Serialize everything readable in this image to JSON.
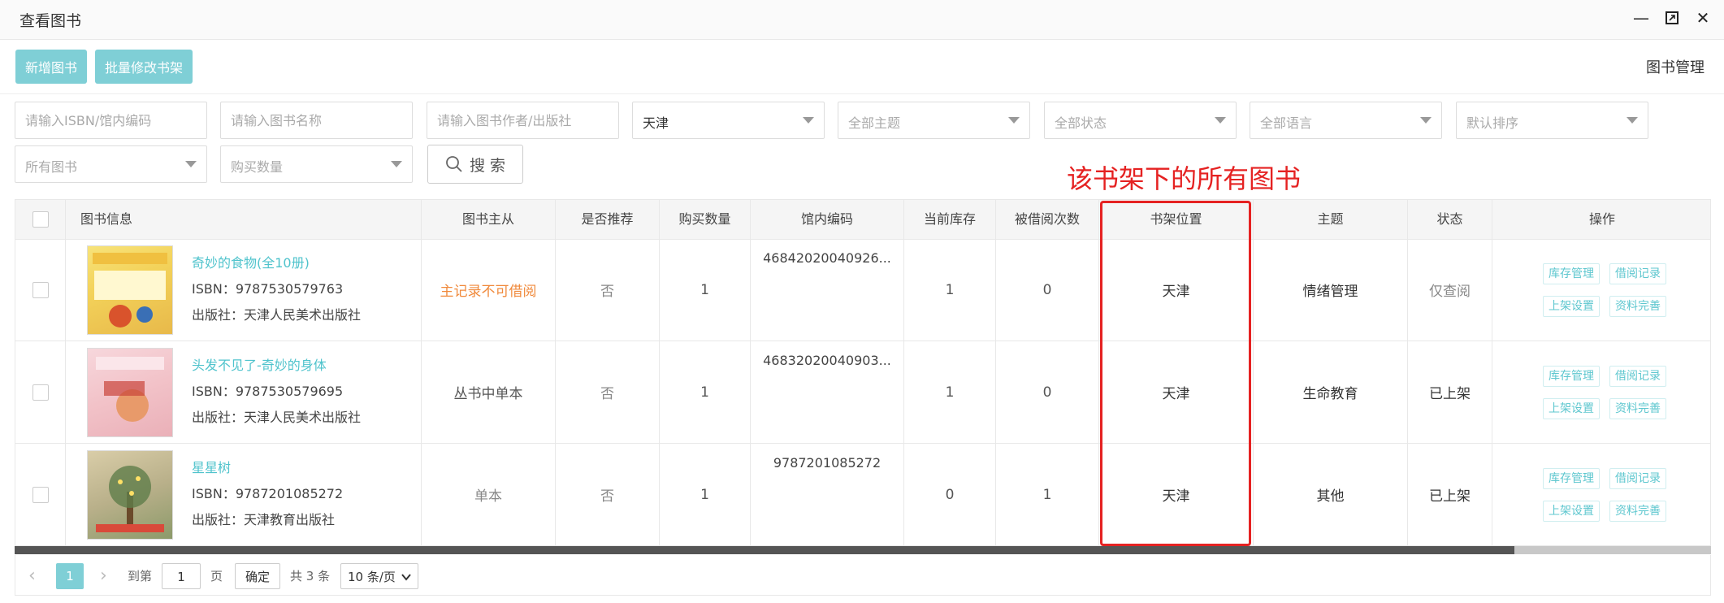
{
  "window": {
    "title": "查看图书",
    "controls": [
      "minimize",
      "maximize",
      "close"
    ]
  },
  "toolbar": {
    "add_book": "新增图书",
    "batch_shelf": "批量修改书架",
    "page_title": "图书管理"
  },
  "filters": {
    "isbn_placeholder": "请输入ISBN/馆内编码",
    "name_placeholder": "请输入图书名称",
    "author_placeholder": "请输入图书作者/出版社",
    "location_value": "天津",
    "theme": "全部主题",
    "status": "全部状态",
    "language": "全部语言",
    "sort": "默认排序",
    "scope": "所有图书",
    "purchase_count": "购买数量",
    "search_label": "搜 索"
  },
  "annotation": "该书架下的所有图书",
  "table": {
    "headers": {
      "book_info": "图书信息",
      "main_sub": "图书主从",
      "recommended": "是否推荐",
      "purchase": "购买数量",
      "code": "馆内编码",
      "stock": "当前库存",
      "borrows": "被借阅次数",
      "shelf": "书架位置",
      "theme": "主题",
      "status": "状态",
      "actions": "操作"
    },
    "rows": [
      {
        "title": "奇妙的食物(全10册)",
        "isbn": "ISBN：9787530579763",
        "publisher": "出版社：天津人民美术出版社",
        "main_sub": "主记录不可借阅",
        "recommended": "否",
        "purchase": "1",
        "code": "46842020040926...",
        "stock": "1",
        "borrows": "0",
        "shelf": "天津",
        "theme": "情绪管理",
        "status": "仅查阅"
      },
      {
        "title": "头发不见了-奇妙的身体",
        "isbn": "ISBN：9787530579695",
        "publisher": "出版社：天津人民美术出版社",
        "main_sub": "丛书中单本",
        "recommended": "否",
        "purchase": "1",
        "code": "46832020040903...",
        "stock": "1",
        "borrows": "0",
        "shelf": "天津",
        "theme": "生命教育",
        "status": "已上架"
      },
      {
        "title": "星星树",
        "isbn": "ISBN：9787201085272",
        "publisher": "出版社：天津教育出版社",
        "main_sub": "单本",
        "recommended": "否",
        "purchase": "1",
        "code": "9787201085272",
        "stock": "0",
        "borrows": "1",
        "shelf": "天津",
        "theme": "其他",
        "status": "已上架"
      }
    ],
    "actions": {
      "stock_mgmt": "库存管理",
      "borrow_record": "借阅记录",
      "shelf_setting": "上架设置",
      "complete_info": "资料完善"
    }
  },
  "pager": {
    "prev": "‹",
    "current_page": "1",
    "next": "›",
    "goto_label": "到第",
    "page_input": "1",
    "page_unit": "页",
    "confirm": "确定",
    "total": "共 3 条",
    "page_size": "10 条/页"
  },
  "colors": {
    "accent": "#7fcfd6",
    "link": "#4fc3cc",
    "warning": "#f08a3c",
    "annotation": "#e52222"
  }
}
